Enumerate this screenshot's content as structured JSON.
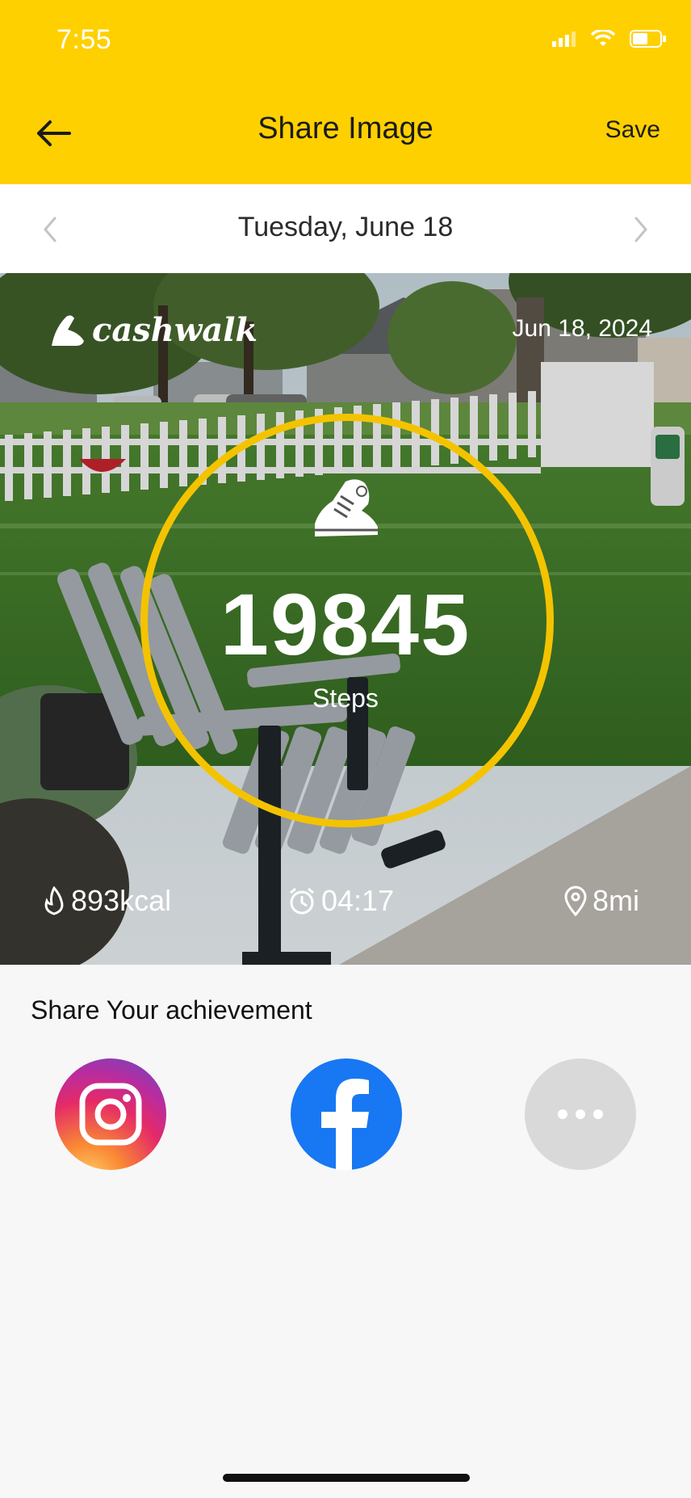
{
  "status_bar": {
    "time": "7:55"
  },
  "nav": {
    "title": "Share Image",
    "save_label": "Save"
  },
  "date_bar": {
    "date": "Tuesday, June 18"
  },
  "photo_card": {
    "brand": "cashwalk",
    "date": "Jun 18, 2024",
    "steps": "19845",
    "steps_label": "Steps",
    "calories": "893kcal",
    "duration": "04:17",
    "distance": "8mi"
  },
  "share": {
    "title": "Share Your achievement"
  },
  "colors": {
    "accent": "#ffd000",
    "ring": "#f4c300",
    "facebook": "#1877f2",
    "more": "#d9d9d9"
  },
  "icons": [
    "back-arrow-icon",
    "chevron-left-icon",
    "chevron-right-icon",
    "shoe-icon",
    "flame-icon",
    "timer-icon",
    "location-pin-icon",
    "instagram-icon",
    "facebook-icon",
    "more-icon"
  ]
}
